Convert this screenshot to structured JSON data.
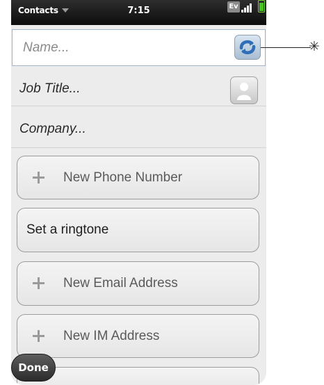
{
  "status_bar": {
    "app_menu": "Contacts",
    "time": "7:15",
    "network_badge": "Ev"
  },
  "name_field": {
    "placeholder": "Name...",
    "sync_icon": "sync-profiles-icon"
  },
  "job_title": {
    "text": "Job Title...",
    "photo_icon": "contact-photo-icon"
  },
  "company": {
    "text": "Company..."
  },
  "groups": {
    "phone": "New Phone Number",
    "ringtone": "Set a ringtone",
    "email": "New Email Address",
    "im": "New IM Address"
  },
  "done_button": {
    "label": "Done"
  },
  "callout": {
    "marker_icon": "callout-asterisk-icon",
    "marker_glyph": "✳"
  }
}
